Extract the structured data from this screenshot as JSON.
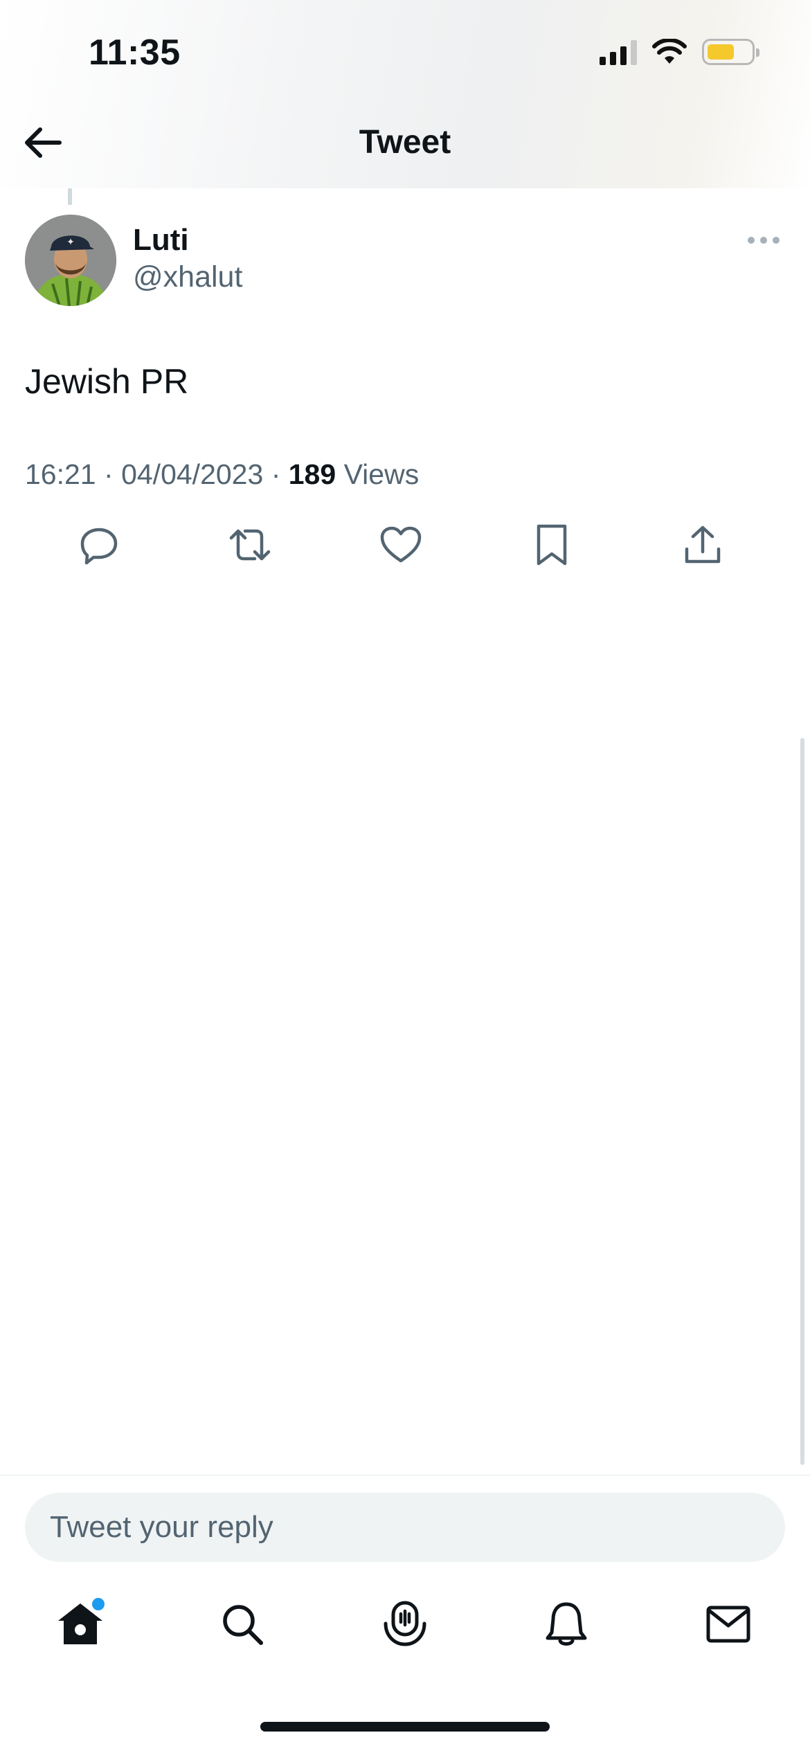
{
  "status_bar": {
    "time": "11:35"
  },
  "header": {
    "title": "Tweet"
  },
  "tweet": {
    "author_name": "Luti",
    "author_handle": "@xhalut",
    "text": "Jewish PR",
    "time": "16:21",
    "date": "04/04/2023",
    "separator": "·",
    "views_count": "189",
    "views_label": "Views"
  },
  "reply": {
    "placeholder": "Tweet your reply"
  },
  "tabs": [
    {
      "name": "home",
      "icon": "home-icon"
    },
    {
      "name": "search",
      "icon": "search-icon"
    },
    {
      "name": "spaces",
      "icon": "spaces-icon"
    },
    {
      "name": "notifications",
      "icon": "bell-icon"
    },
    {
      "name": "messages",
      "icon": "envelope-icon"
    }
  ],
  "colors": {
    "accent": "#1d9bf0",
    "text_primary": "#0f1419",
    "text_secondary": "#536471",
    "battery": "#f5c82b"
  }
}
